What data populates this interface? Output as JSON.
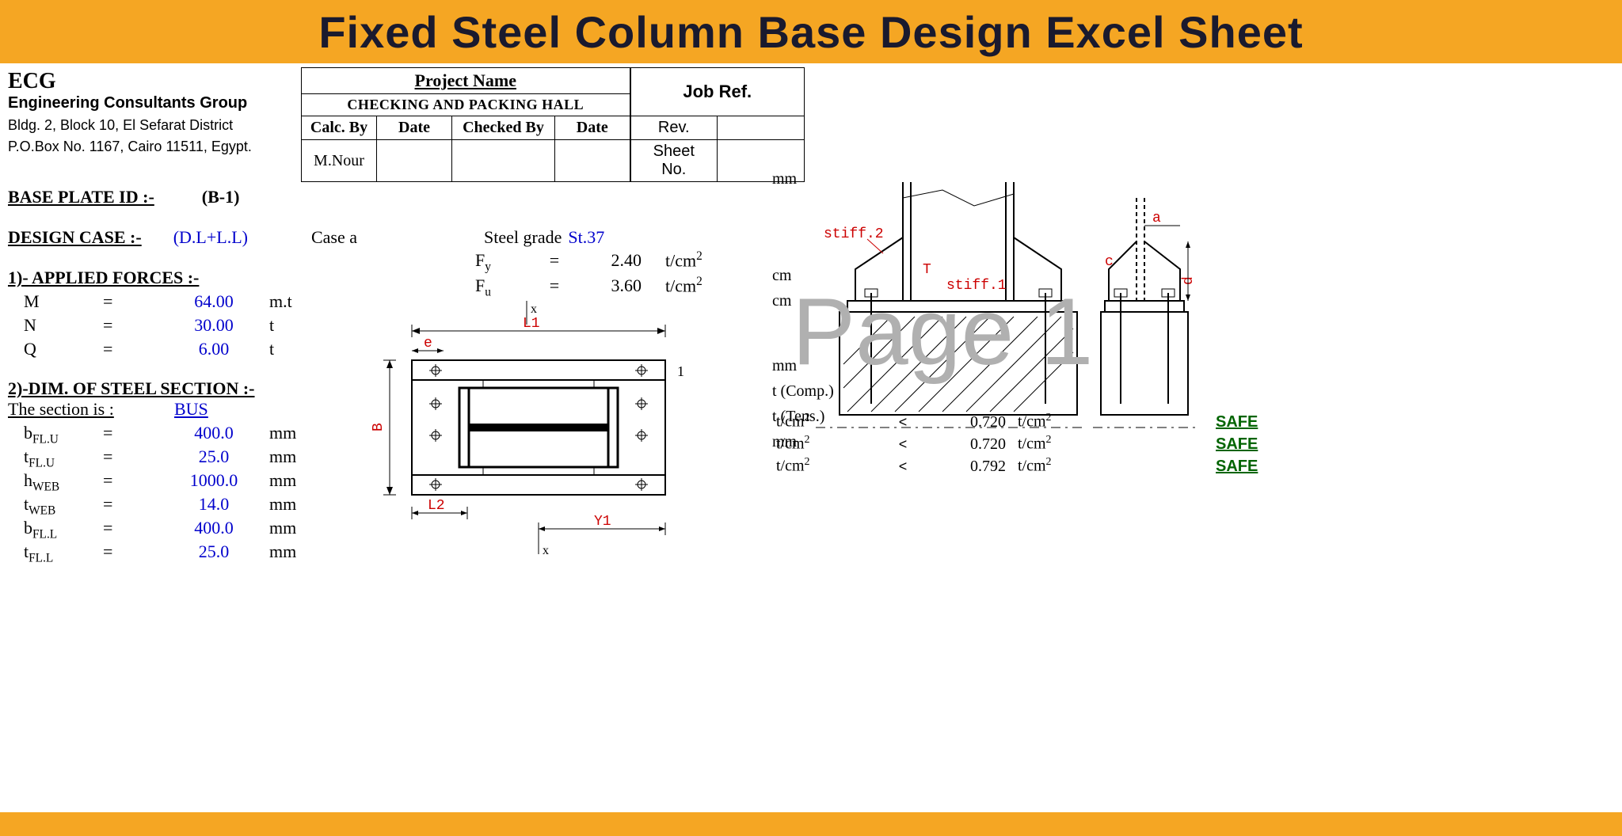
{
  "banner": {
    "title": "Fixed Steel Column Base Design Excel Sheet"
  },
  "header": {
    "company_abbr": "ECG",
    "company_name": "Engineering Consultants Group",
    "addr1": "Bldg. 2, Block 10, El Sefarat District",
    "addr2": "P.O.Box No. 1167, Cairo 11511, Egypt.",
    "project_name_label": "Project Name",
    "project_name": "CHECKING AND PACKING HALL",
    "job_ref_label": "Job Ref.",
    "calc_by_label": "Calc. By",
    "date_label": "Date",
    "checked_by_label": "Checked By",
    "date2_label": "Date",
    "rev_label": "Rev.",
    "sheet_no_label": "Sheet No.",
    "calc_by": "M.Nour"
  },
  "plate": {
    "label": "BASE PLATE ID :-",
    "id": "(B-1)"
  },
  "design_case": {
    "label": "DESIGN CASE :-",
    "value": "(D.L+L.L)",
    "case_text": "Case a",
    "grade_label": "Steel grade",
    "grade": "St.37"
  },
  "fy": {
    "sym": "Fy",
    "sub": "y",
    "val": "2.40",
    "unit": "t/cm²"
  },
  "fu": {
    "sym": "Fu",
    "sub": "u",
    "val": "3.60",
    "unit": "t/cm²"
  },
  "forces": {
    "title": "1)- APPLIED FORCES :-",
    "rows": [
      {
        "sym": "M",
        "val": "64.00",
        "unit": "m.t"
      },
      {
        "sym": "N",
        "val": "30.00",
        "unit": "t"
      },
      {
        "sym": "Q",
        "val": "6.00",
        "unit": "t"
      }
    ]
  },
  "dims": {
    "title": "2)-DIM. OF STEEL SECTION :-",
    "section_label": "The section is :",
    "section_type": "BUS",
    "rows": [
      {
        "sym": "b",
        "sub": "FL.U",
        "val": "400.0",
        "unit": "mm"
      },
      {
        "sym": "t",
        "sub": "FL.U",
        "val": "25.0",
        "unit": "mm"
      },
      {
        "sym": "h",
        "sub": "WEB",
        "val": "1000.0",
        "unit": "mm"
      },
      {
        "sym": "t",
        "sub": "WEB",
        "val": "14.0",
        "unit": "mm"
      },
      {
        "sym": "b",
        "sub": "FL.L",
        "val": "400.0",
        "unit": "mm"
      },
      {
        "sym": "t",
        "sub": "FL.L",
        "val": "25.0",
        "unit": "mm"
      }
    ]
  },
  "right_units": {
    "lines": [
      "mm",
      "cm",
      "cm",
      "mm",
      "t (Comp.)",
      "t (Tens.)",
      "mm"
    ]
  },
  "results": {
    "rows": [
      {
        "unit1": "t/cm²",
        "op": "<",
        "limit": "0.720",
        "unit2": "t/cm²",
        "status": "SAFE"
      },
      {
        "unit1": "t/cm²",
        "op": "<",
        "limit": "0.720",
        "unit2": "t/cm²",
        "status": "SAFE"
      },
      {
        "unit1": "t/cm²",
        "op": "<",
        "limit": "0.792",
        "unit2": "t/cm²",
        "status": "SAFE"
      }
    ]
  },
  "diagram": {
    "L1": "L1",
    "L2": "L2",
    "B": "B",
    "e": "e",
    "Y1": "Y1",
    "x_top": "x",
    "x_bot": "x",
    "one": "1",
    "stiff1": "stiff.1",
    "stiff2": "stiff.2",
    "a": "a",
    "c": "c",
    "d": "d",
    "T": "T"
  },
  "watermark": "Page 1"
}
